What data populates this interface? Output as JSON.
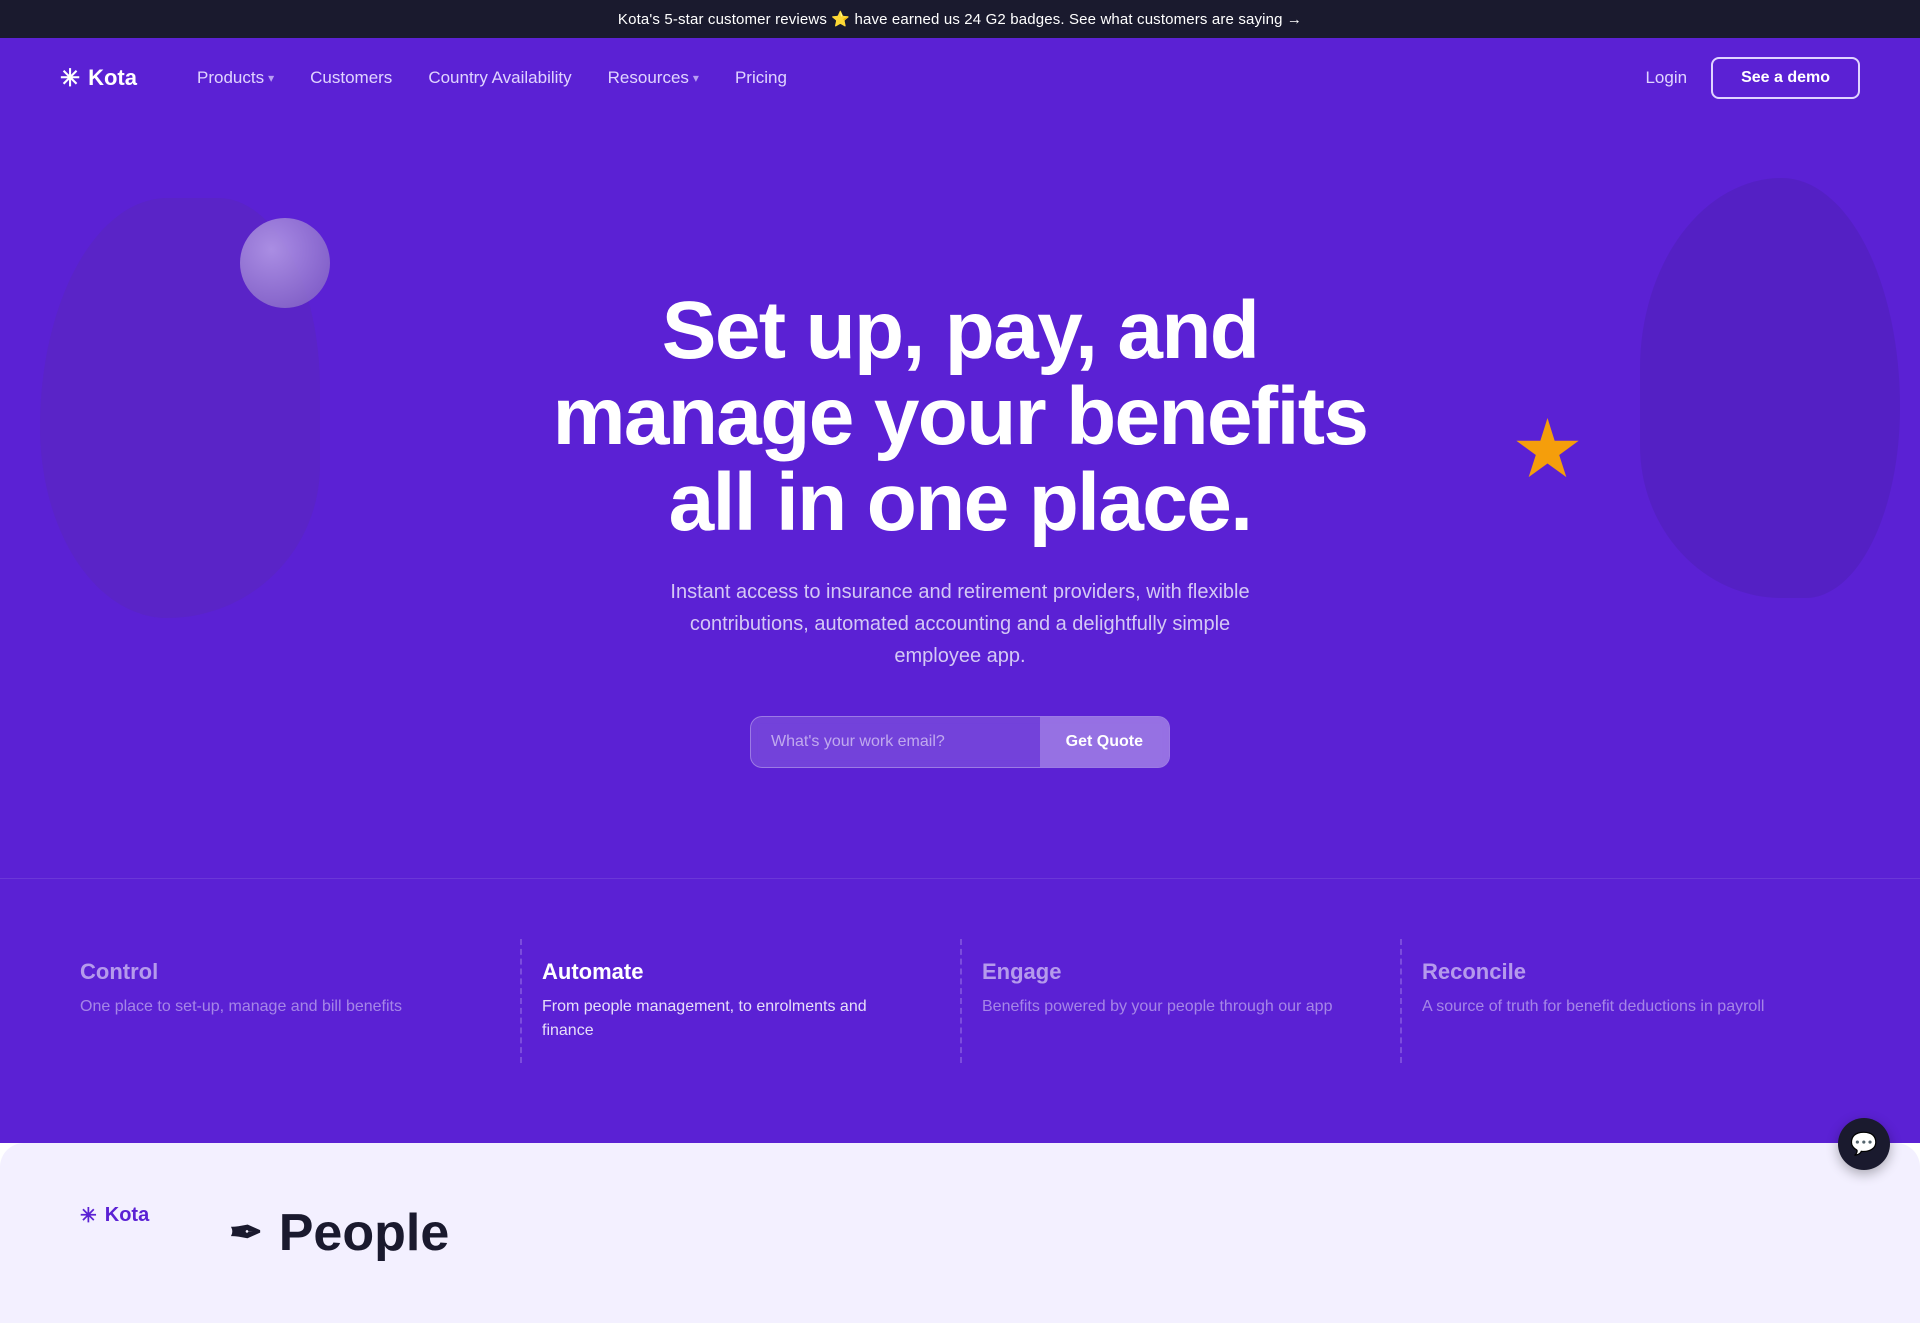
{
  "announcement": {
    "text": "Kota's 5-star customer reviews ⭐ have earned us 24 G2 badges. See what customers are saying →"
  },
  "nav": {
    "logo_icon": "✳",
    "logo_text": "Kota",
    "links": [
      {
        "label": "Products",
        "has_dropdown": true
      },
      {
        "label": "Customers",
        "has_dropdown": false
      },
      {
        "label": "Country Availability",
        "has_dropdown": false
      },
      {
        "label": "Resources",
        "has_dropdown": true
      },
      {
        "label": "Pricing",
        "has_dropdown": false
      }
    ],
    "login_label": "Login",
    "demo_label": "See a demo"
  },
  "hero": {
    "title": "Set up, pay, and manage your benefits all in one place.",
    "subtitle": "Instant access to insurance and retirement providers, with flexible contributions, automated accounting and a delightfully simple employee app.",
    "email_placeholder": "What's your work email?",
    "cta_label": "Get Quote"
  },
  "features": [
    {
      "title": "Control",
      "desc": "One place to set-up, manage and bill benefits",
      "active": false
    },
    {
      "title": "Automate",
      "desc": "From people management, to enrolments and finance",
      "active": true
    },
    {
      "title": "Engage",
      "desc": "Benefits powered by your people through our app",
      "active": false
    },
    {
      "title": "Reconcile",
      "desc": "A source of truth for benefit deductions in payroll",
      "active": false
    }
  ],
  "bottom": {
    "logo_icon": "✳",
    "logo_text": "Kota",
    "section_icon": "✒",
    "section_title": "People"
  },
  "chat": {
    "icon": "💬"
  }
}
